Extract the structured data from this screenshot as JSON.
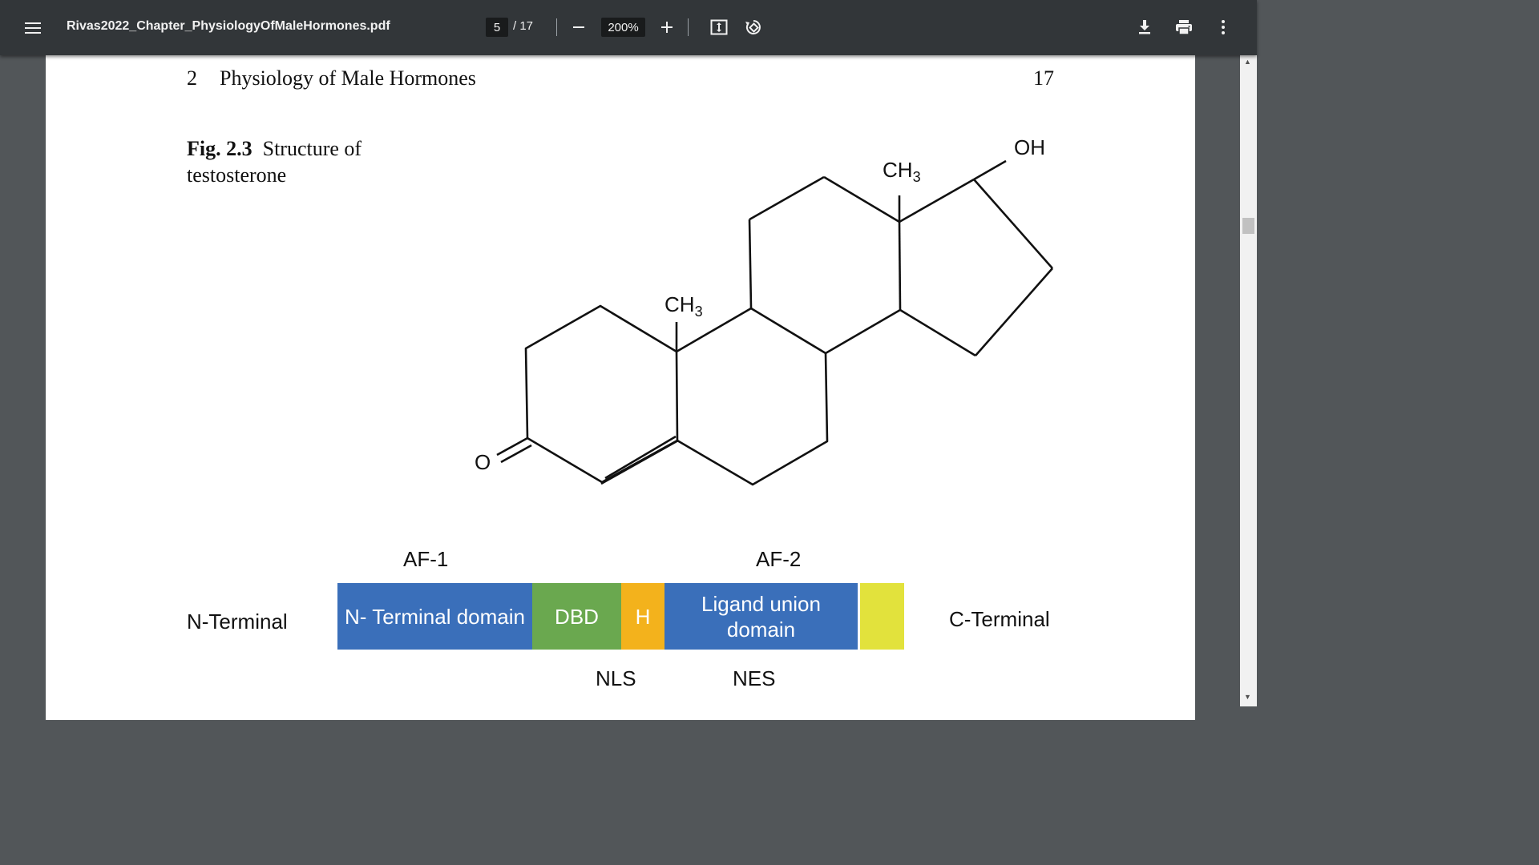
{
  "toolbar": {
    "title": "Rivas2022_Chapter_PhysiologyOfMaleHormones.pdf",
    "page_current": "5",
    "page_total": "/ 17",
    "zoom": "200%",
    "icons": [
      "menu-icon",
      "zoom-out-icon",
      "zoom-in-icon",
      "fit-page-icon",
      "rotate-icon",
      "download-icon",
      "print-icon",
      "more-vert-icon"
    ]
  },
  "page": {
    "header_chapter": "2",
    "header_title": "Physiology of Male Hormones",
    "header_page": "17",
    "figure_label": "Fig. 2.3",
    "figure_caption": "Structure of testosterone",
    "molecule": {
      "oh": "OH",
      "ch3": "CH",
      "sub3": "3",
      "o": "O"
    },
    "domain_diagram": {
      "af1": "AF-1",
      "af2": "AF-2",
      "n_terminal": "N-Terminal",
      "c_terminal": "C-Terminal",
      "seg_ntd": "N- Terminal domain",
      "seg_dbd": "DBD",
      "seg_h": "H",
      "seg_lbd": "Ligand union domain",
      "nls": "NLS",
      "nes": "NES",
      "colors": {
        "ntd": "#3a6fba",
        "dbd": "#6aa84f",
        "h": "#f3b21c",
        "lbd": "#3a6fba",
        "end": "#e2e23c"
      }
    }
  }
}
